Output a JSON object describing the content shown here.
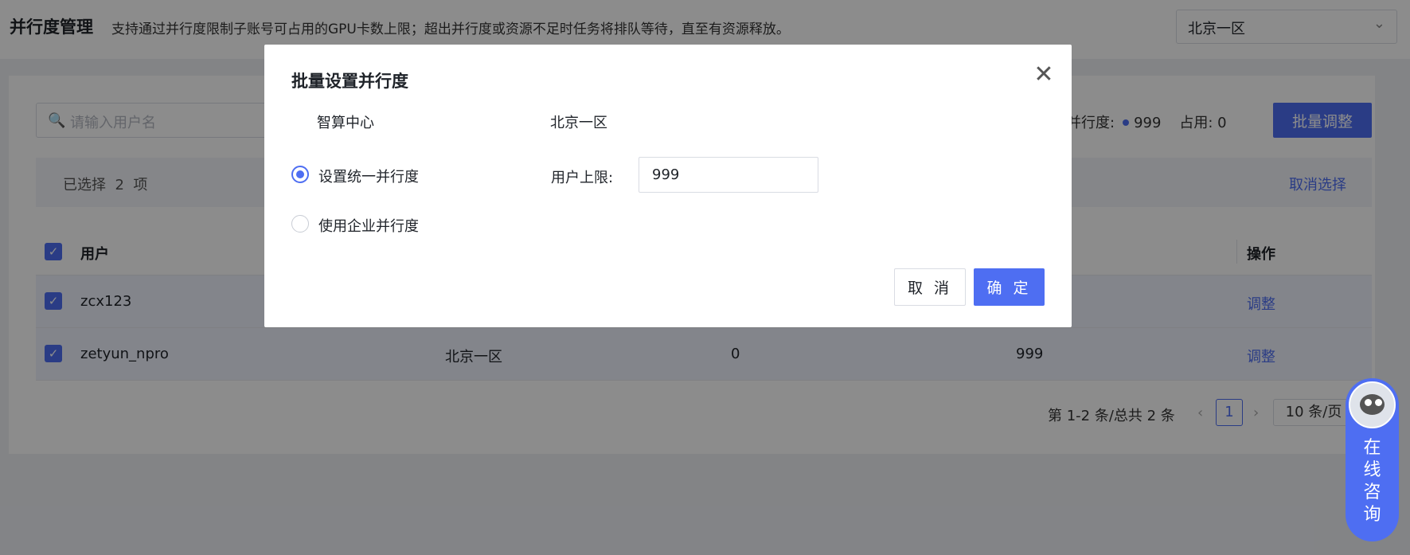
{
  "header": {
    "title": "并行度管理",
    "description": "支持通过并行度限制子账号可占用的GPU卡数上限；超出并行度或资源不足时任务将排队等待，直至有资源释放。",
    "region": "北京一区"
  },
  "toolbar": {
    "search_placeholder": "请输入用户名",
    "parallel_label": "并行度:",
    "parallel_value": "999",
    "used_label": "占用:",
    "used_value": "0",
    "batch_button": "批量调整"
  },
  "selection": {
    "prefix": "已选择",
    "count": "2",
    "suffix": "项",
    "clear": "取消选择"
  },
  "table": {
    "headers": {
      "user": "用户",
      "action": "操作"
    },
    "rows": [
      {
        "user": "zcx123",
        "region": "",
        "used": "",
        "limit": "",
        "action": "调整"
      },
      {
        "user": "zetyun_npro",
        "region": "北京一区",
        "used": "0",
        "limit": "999",
        "action": "调整"
      }
    ]
  },
  "pagination": {
    "summary": "第 1-2 条/总共 2 条",
    "current_page": "1",
    "page_size": "10 条/页"
  },
  "chat": {
    "label": "在线咨询"
  },
  "modal": {
    "title": "批量设置并行度",
    "org": "智算中心",
    "region": "北京一区",
    "options": [
      {
        "label": "设置统一并行度",
        "selected": true
      },
      {
        "label": "使用企业并行度",
        "selected": false
      }
    ],
    "limit_label": "用户上限:",
    "limit_value": "999",
    "cancel": "取 消",
    "confirm": "确 定"
  },
  "colors": {
    "primary": "#4e6ef2",
    "mask": "rgba(0,0,0,0.45)"
  }
}
